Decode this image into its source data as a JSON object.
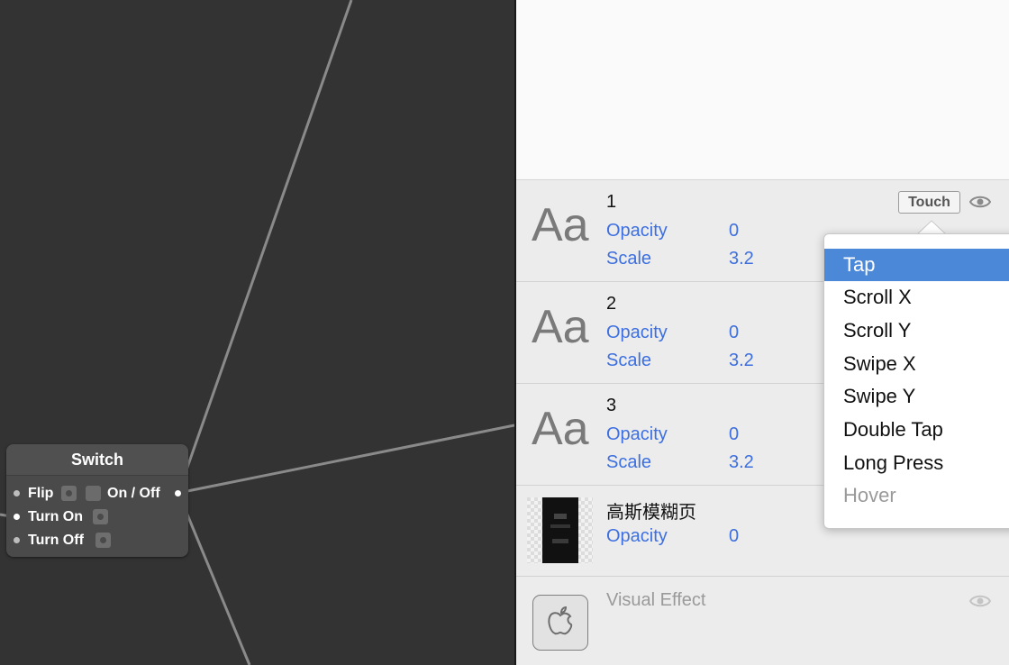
{
  "node": {
    "title": "Switch",
    "ports": {
      "flip": "Flip",
      "on_off": "On / Off",
      "turn_on": "Turn On",
      "turn_off": "Turn Off"
    }
  },
  "layers": [
    {
      "glyph": "Aa",
      "name": "1",
      "props": [
        {
          "label": "Opacity",
          "value": "0"
        },
        {
          "label": "Scale",
          "value": "3.2"
        }
      ]
    },
    {
      "glyph": "Aa",
      "name": "2",
      "props": [
        {
          "label": "Opacity",
          "value": "0"
        },
        {
          "label": "Scale",
          "value": "3.2"
        }
      ]
    },
    {
      "glyph": "Aa",
      "name": "3",
      "props": [
        {
          "label": "Opacity",
          "value": "0"
        },
        {
          "label": "Scale",
          "value": "3.2"
        }
      ]
    },
    {
      "name": "高斯模糊页",
      "props": [
        {
          "label": "Opacity",
          "value": "0"
        }
      ]
    },
    {
      "name": "Visual Effect"
    }
  ],
  "touch_button": "Touch",
  "touch_menu": {
    "selected": "Tap",
    "items": [
      "Tap",
      "Scroll X",
      "Scroll Y",
      "Swipe X",
      "Swipe Y",
      "Double Tap",
      "Long Press",
      "Hover"
    ],
    "disabled": [
      "Hover"
    ]
  },
  "colors": {
    "canvas": "#333333",
    "prop_blue": "#3d6fe0",
    "menu_selected": "#4c88d8"
  }
}
